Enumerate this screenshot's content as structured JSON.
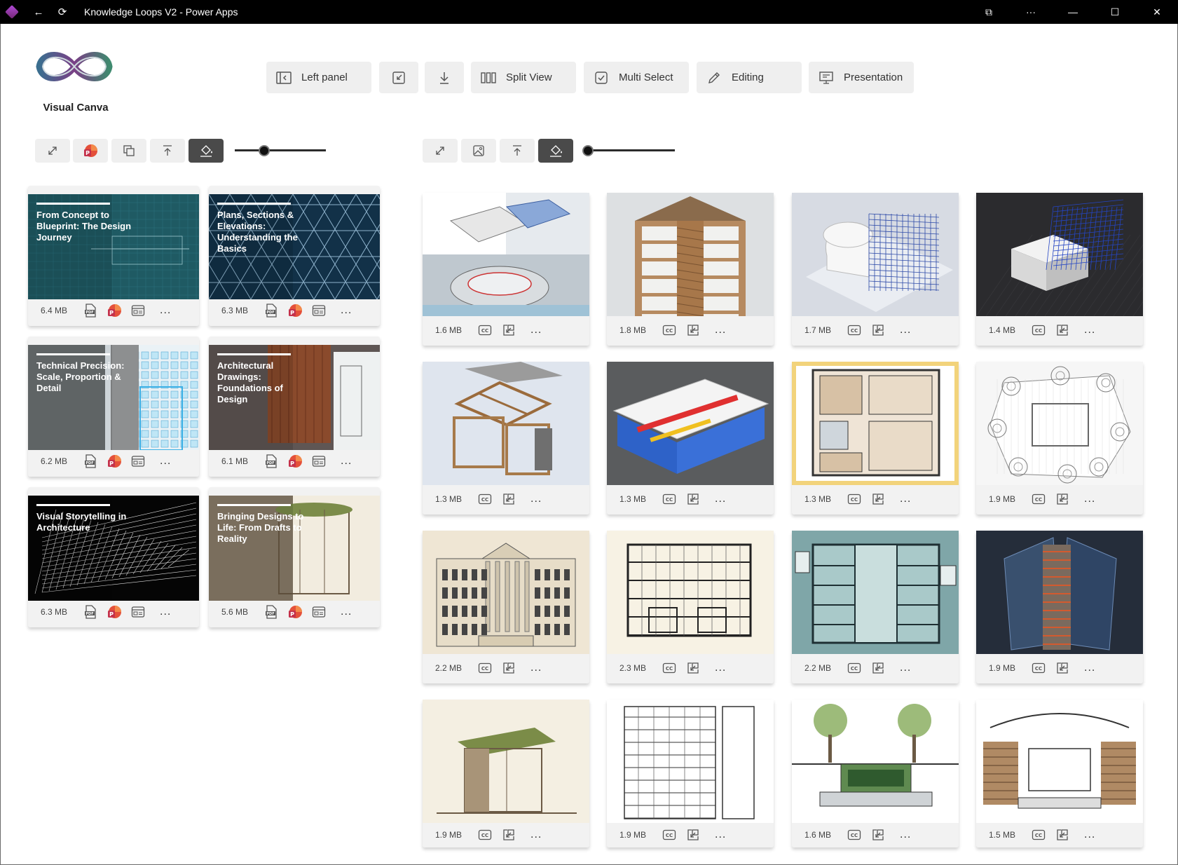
{
  "window": {
    "title": "Knowledge Loops V2 - Power Apps"
  },
  "brand": {
    "name": "Visual Canva"
  },
  "toolbar": {
    "left_panel": "Left panel",
    "split_view": "Split View",
    "multi_select": "Multi Select",
    "editing": "Editing",
    "presentation": "Presentation"
  },
  "decks": [
    {
      "title": "From Concept to Blueprint: The Design Journey",
      "size": "6.4 MB",
      "theme": "#1f5a63"
    },
    {
      "title": "Plans, Sections & Elevations: Understanding the Basics",
      "size": "6.3 MB",
      "theme": "#123148"
    },
    {
      "title": "Technical Precision: Scale, Proportion & Detail",
      "size": "6.2 MB",
      "theme": "#4f5658"
    },
    {
      "title": "Architectural Drawings: Foundations of Design",
      "size": "6.1 MB",
      "theme": "#5c3a27"
    },
    {
      "title": "Visual Storytelling in Architecture",
      "size": "6.3 MB",
      "theme": "#050505"
    },
    {
      "title": "Bringing Designs to Life: From Drafts to Reality",
      "size": "5.6 MB",
      "theme": "#8a7a62"
    }
  ],
  "images": [
    {
      "size": "1.6 MB",
      "kind": "bim-split"
    },
    {
      "size": "1.8 MB",
      "kind": "tower-section"
    },
    {
      "size": "1.7 MB",
      "kind": "white-model"
    },
    {
      "size": "1.4 MB",
      "kind": "dark-model"
    },
    {
      "size": "1.3 MB",
      "kind": "timber-frame"
    },
    {
      "size": "1.3 MB",
      "kind": "mep-model"
    },
    {
      "size": "1.3 MB",
      "kind": "floor-plan"
    },
    {
      "size": "1.9 MB",
      "kind": "site-plan"
    },
    {
      "size": "2.2 MB",
      "kind": "classical-facade"
    },
    {
      "size": "2.3 MB",
      "kind": "building-section"
    },
    {
      "size": "2.2 MB",
      "kind": "blueprint-section"
    },
    {
      "size": "1.9 MB",
      "kind": "exploded-tower"
    },
    {
      "size": "1.9 MB",
      "kind": "green-roof-sketch"
    },
    {
      "size": "1.9 MB",
      "kind": "library-section"
    },
    {
      "size": "1.6 MB",
      "kind": "landscape-section"
    },
    {
      "size": "1.5 MB",
      "kind": "auditorium-section"
    }
  ],
  "more_label": "...",
  "icons": {
    "pdf": "pdf-icon",
    "ppt": "powerpoint-icon",
    "cc": "closed-caption-icon",
    "open": "open-in-new-icon",
    "slides": "slides-icon"
  },
  "colors": {
    "selected_outline": "#f2d37b",
    "button_bg": "#efefef",
    "active_button_bg": "#4a4a4a"
  },
  "left_slider": {
    "value": 0.33
  },
  "right_slider": {
    "value": 0.0
  }
}
